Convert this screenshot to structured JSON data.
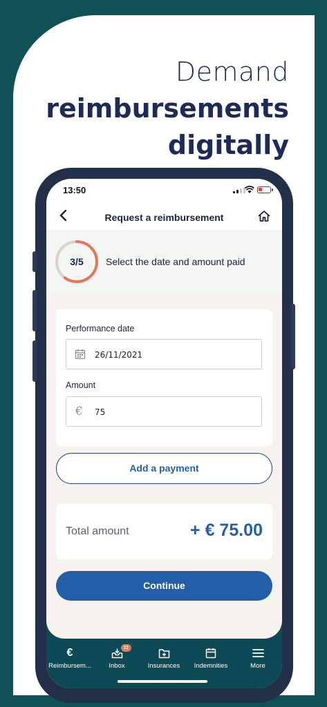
{
  "headline": {
    "line1": "Demand",
    "line2": "reimbursements",
    "line3": "digitally"
  },
  "statusbar": {
    "time": "13:50"
  },
  "header": {
    "title": "Request a reimbursement"
  },
  "stepper": {
    "count": "3/5",
    "label": "Select the date and amount paid",
    "progress": 0.6
  },
  "form": {
    "date_label": "Performance date",
    "date_value": "26/11/2021",
    "amount_label": "Amount",
    "amount_currency": "€",
    "amount_value": "75"
  },
  "add_payment_label": "Add a payment",
  "total": {
    "label": "Total amount",
    "value": "+ € 75.00"
  },
  "continue_label": "Continue",
  "tabs": [
    {
      "label": "Reimbursem...",
      "icon": "euro-icon"
    },
    {
      "label": "Inbox",
      "icon": "inbox-icon",
      "badge": "11"
    },
    {
      "label": "Insurances",
      "icon": "folder-icon"
    },
    {
      "label": "Indemnities",
      "icon": "calendar-icon"
    },
    {
      "label": "More",
      "icon": "menu-icon"
    }
  ],
  "colors": {
    "background": "#0f5156",
    "navy": "#1c2340",
    "accent_blue": "#235ea8",
    "progress_ring": "#e07858",
    "tabbar": "#0e4a55"
  }
}
